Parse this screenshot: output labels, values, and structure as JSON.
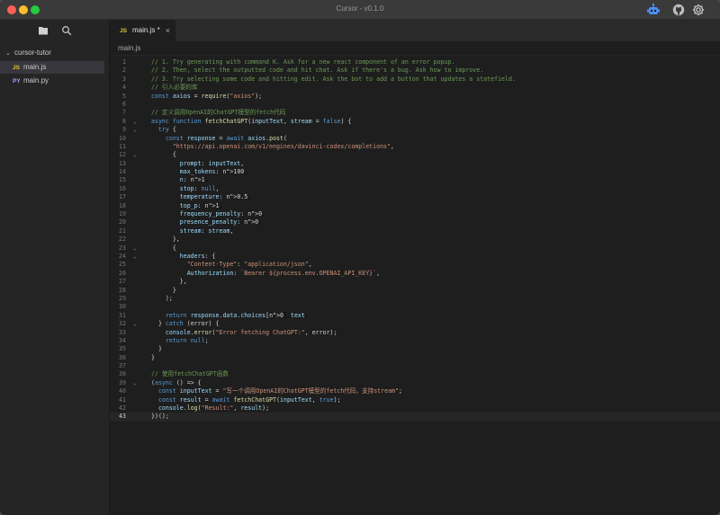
{
  "window": {
    "title": "Cursor - v0.1.0"
  },
  "titlebar_icons": [
    "robot-icon",
    "github-icon",
    "gear-icon"
  ],
  "sidebar": {
    "icons": [
      "files-icon",
      "search-icon"
    ],
    "folder": "cursor-tutor",
    "files": [
      {
        "type": "JS",
        "name": "main.js",
        "active": true
      },
      {
        "type": "PY",
        "name": "main.py",
        "active": false
      }
    ]
  },
  "tab": {
    "type": "JS",
    "label": "main.js *",
    "close": "×"
  },
  "breadcrumb": "main.js",
  "current_line": 43,
  "code_lines": [
    "// 1. Try generating with command K. Ask for a new react component of an error popup.",
    "// 2. Then, select the outputted code and hit chat. Ask if there's a bug. Ask how to improve.",
    "// 3. Try selecting some code and hitting edit. Ask the bot to add a button that updates a statefield.",
    "// 引入必要的库",
    "const axios = require(\"axios\");",
    "",
    "// 定义调用OpenAI的ChatGPT模型的fetch代码",
    "async function fetchChatGPT(inputText, stream = false) {",
    "  try {",
    "    const response = await axios.post(",
    "      \"https://api.openai.com/v1/engines/davinci-codex/completions\",",
    "      {",
    "        prompt: inputText,",
    "        max_tokens: 100,",
    "        n: 1,",
    "        stop: null,",
    "        temperature: 0.5,",
    "        top_p: 1,",
    "        frequency_penalty: 0,",
    "        presence_penalty: 0,",
    "        stream: stream,",
    "      },",
    "      {",
    "        headers: {",
    "          \"Content-Type\": \"application/json\",",
    "          Authorization: `Bearer ${process.env.OPENAI_API_KEY}`,",
    "        },",
    "      }",
    "    );",
    "",
    "    return response.data.choices[0].text;",
    "  } catch (error) {",
    "    console.error(\"Error fetching ChatGPT:\", error);",
    "    return null;",
    "  }",
    "}",
    "",
    "// 使用fetchChatGPT函数",
    "(async () => {",
    "  const inputText = \"写一个调用OpenAI的ChatGPT模型的fetch代码，支持stream\";",
    "  const result = await fetchChatGPT(inputText, true);",
    "  console.log(\"Result:\", result);",
    "})();"
  ],
  "fold_markers": [
    8,
    9,
    12,
    23,
    24,
    32,
    39
  ],
  "colors": {
    "comment": "#6a9955",
    "keyword": "#569cd6",
    "string": "#ce9178",
    "number": "#b5cea8",
    "function": "#dcdcaa",
    "variable": "#9cdcfe",
    "punctuation": "#d4d4d4"
  }
}
